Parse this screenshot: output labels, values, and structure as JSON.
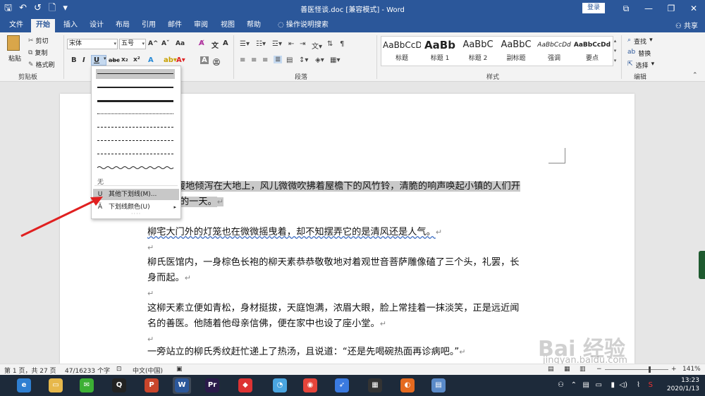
{
  "window": {
    "title": "善医怪谈.doc [兼容模式] - Word",
    "login": "登录",
    "qat": [
      "🖫",
      "↶",
      "↺",
      "🗋",
      "▾"
    ],
    "controls": [
      "⧉",
      "—",
      "❐",
      "✕"
    ]
  },
  "tabs": [
    {
      "label": "文件",
      "active": false
    },
    {
      "label": "开始",
      "active": true
    },
    {
      "label": "插入",
      "active": false
    },
    {
      "label": "设计",
      "active": false
    },
    {
      "label": "布局",
      "active": false
    },
    {
      "label": "引用",
      "active": false
    },
    {
      "label": "邮件",
      "active": false
    },
    {
      "label": "审阅",
      "active": false
    },
    {
      "label": "视图",
      "active": false
    },
    {
      "label": "帮助",
      "active": false
    },
    {
      "label": "操作说明搜索",
      "active": false
    }
  ],
  "share": "共享",
  "clipboard": {
    "paste": "粘贴",
    "cut": "剪切",
    "copy": "复制",
    "format_painter": "格式刷",
    "group": "剪贴板"
  },
  "font": {
    "name": "宋体",
    "size": "五号",
    "grow": "A^",
    "shrink": "Aˇ",
    "case": "Aa",
    "bold": "B",
    "italic": "I",
    "underline": "U",
    "strike": "abc",
    "sub": "x₂",
    "sup": "x²",
    "group": "字体"
  },
  "paragraph": {
    "group": "段落"
  },
  "styles": {
    "group": "样式",
    "items": [
      {
        "preview": "AaBbCcDd",
        "name": "标题"
      },
      {
        "preview": "AaBb",
        "name": "标题 1"
      },
      {
        "preview": "AaBbC",
        "name": "标题 2"
      },
      {
        "preview": "AaBbC",
        "name": "副标题"
      },
      {
        "preview": "AaBbCcDd",
        "name": "强调"
      },
      {
        "preview": "AaBbCcDd",
        "name": "要点"
      }
    ]
  },
  "editing": {
    "group": "编辑",
    "find": "查找",
    "replace": "替换",
    "select": "选择"
  },
  "underline_menu": {
    "none": "无",
    "more": "其他下划线(M)...",
    "color": "下划线颜色(U)",
    "grip": "····"
  },
  "document": {
    "p1_line1": "暖地倾泻在大地上，风儿微微吹拂着屋檐下的风竹铃，清脆的响声唤起小镇的人们开",
    "p1_line2": "的一天。",
    "p2": "柳宅大门外的灯笼也在微微摇曳着，却不知摆弄它的是清风还是人气。",
    "p3_line1": "柳氏医馆内，一身棕色长袍的柳天素恭恭敬敬地对着观世音菩萨雕像磕了三个头，礼罢，长",
    "p3_line2": "身而起。",
    "p4_line1": "这柳天素立便如青松，身材挺拔，天庭饱满，浓眉大眼，脸上常挂着一抹淡笑，正是远近闻",
    "p4_line2": "名的善医。他随着他母亲信佛，便在家中也设了座小堂。",
    "p5": "一旁站立的柳氏秀纹赶忙递上了热汤，且说道：“还是先喝碗热面再诊病吧。”",
    "para_mark": "↵"
  },
  "status": {
    "page": "第 1 页，共 27 页",
    "words": "47/16233 个字",
    "lang": "中文(中国)",
    "zoom": "141%"
  },
  "taskbar": {
    "time": "13:23",
    "date": "2020/1/13",
    "apps": [
      {
        "icon": "browser-icon",
        "color": "#2f7fd1",
        "glyph": "e"
      },
      {
        "icon": "folder-icon",
        "color": "#e7b84b",
        "glyph": "▭"
      },
      {
        "icon": "wechat-icon",
        "color": "#3cb034",
        "glyph": "✉"
      },
      {
        "icon": "qq-icon",
        "color": "#222",
        "glyph": "Q"
      },
      {
        "icon": "powerpoint-icon",
        "color": "#c9452b",
        "glyph": "P"
      },
      {
        "icon": "word-icon",
        "color": "#2b579a",
        "glyph": "W"
      },
      {
        "icon": "premiere-icon",
        "color": "#2a1a4a",
        "glyph": "Pr"
      },
      {
        "icon": "app-icon",
        "color": "#d33",
        "glyph": "◆"
      },
      {
        "icon": "bird-icon",
        "color": "#4aa5e0",
        "glyph": "◔"
      },
      {
        "icon": "chrome-icon",
        "color": "#e5443a",
        "glyph": "◉"
      },
      {
        "icon": "feishu-icon",
        "color": "#3a7ae0",
        "glyph": "➶"
      },
      {
        "icon": "film-icon",
        "color": "#333",
        "glyph": "▦"
      },
      {
        "icon": "firefox-icon",
        "color": "#e56a1f",
        "glyph": "◐"
      },
      {
        "icon": "book-icon",
        "color": "#5a8ac8",
        "glyph": "▤"
      }
    ]
  },
  "watermark": {
    "text": "Bai 经验",
    "sub": "jingyan.baidu.com"
  }
}
